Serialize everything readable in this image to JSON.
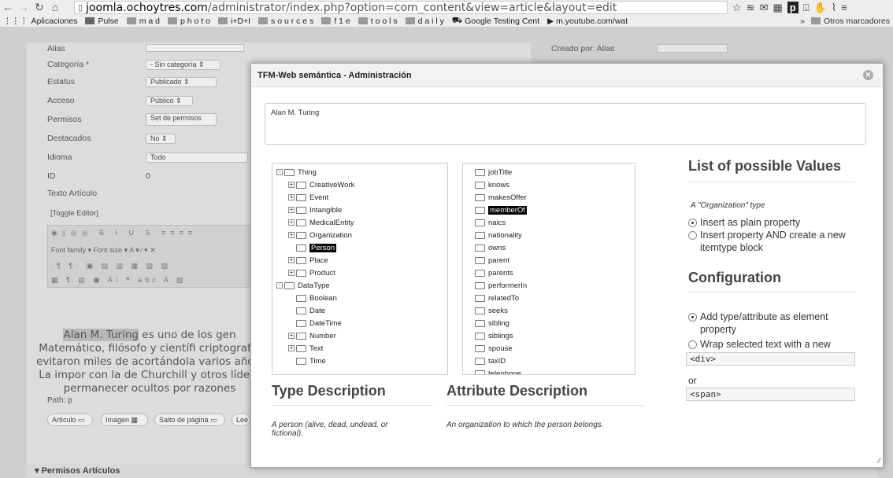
{
  "browser": {
    "url_host": "joomla.ochoytres.com",
    "url_path": "/administrator/index.php?option=com_content&view=article&layout=edit",
    "bookmarks": [
      "Aplicaciones",
      "Pulse",
      "m a d",
      "p h o t o",
      "i+D+I",
      "s o u r c e s",
      "f 1 e",
      "t o o l s",
      "d a i l y",
      "Google Testing Cent",
      "m.youtube.com/wat"
    ],
    "bookmarks_more": "Otros marcadores"
  },
  "form": {
    "alias": "Alias",
    "categoria_label": "Categoría *",
    "categoria_value": "- Sin categoría",
    "estatus_label": "Estatus",
    "estatus_value": "Publicado",
    "acceso_label": "Acceso",
    "acceso_value": "Público",
    "permisos_label": "Permisos",
    "permisos_btn": "Set de permisos",
    "destacados_label": "Destacados",
    "destacados_value": "No",
    "idioma_label": "Idioma",
    "idioma_value": "Todo",
    "id_label": "ID",
    "id_value": "0",
    "texto_label": "Texto Artículo",
    "toggle": "[Toggle Editor]",
    "font_family": "Font family",
    "font_size": "Font size",
    "creado_por": "Creado por: Alias",
    "editor_hl": "Alan M. Turing",
    "editor_rest": " es uno de los gen Matemático, filósofo y científi criptografía evitaron miles de acortándola varios años. La impor con la de Churchill y otros lídere permanecer ocultos por razones",
    "path": "Path: p",
    "btn_articulo": "Artículo",
    "btn_imagen": "Imagen",
    "btn_salto": "Salto de página",
    "btn_lee": "Lee",
    "permisos_articulos": "Permisos Artículos"
  },
  "modal": {
    "title": "TFM-Web semántica - Administración",
    "text": "Alan M. Turing",
    "types": [
      {
        "t": "Thing",
        "d": 0,
        "tog": "-",
        "open": true
      },
      {
        "t": "CreativeWork",
        "d": 1,
        "tog": "+"
      },
      {
        "t": "Event",
        "d": 1,
        "tog": "+"
      },
      {
        "t": "Intangible",
        "d": 1,
        "tog": "+"
      },
      {
        "t": "MedicalEntity",
        "d": 1,
        "tog": "+"
      },
      {
        "t": "Organization",
        "d": 1,
        "tog": "+"
      },
      {
        "t": "Person",
        "d": 1,
        "tog": "",
        "sel": true
      },
      {
        "t": "Place",
        "d": 1,
        "tog": "+"
      },
      {
        "t": "Product",
        "d": 1,
        "tog": "+"
      },
      {
        "t": "DataType",
        "d": 0,
        "tog": "-",
        "open": true
      },
      {
        "t": "Boolean",
        "d": 1,
        "tog": ""
      },
      {
        "t": "Date",
        "d": 1,
        "tog": ""
      },
      {
        "t": "DateTime",
        "d": 1,
        "tog": ""
      },
      {
        "t": "Number",
        "d": 1,
        "tog": "+"
      },
      {
        "t": "Text",
        "d": 1,
        "tog": "+"
      },
      {
        "t": "Time",
        "d": 1,
        "tog": ""
      }
    ],
    "attrs": [
      "jobTitle",
      "knows",
      "makesOffer",
      "memberOf",
      "naics",
      "nationality",
      "owns",
      "parent",
      "parents",
      "performerIn",
      "relatedTo",
      "seeks",
      "sibling",
      "siblings",
      "spouse",
      "taxID",
      "telephone"
    ],
    "attr_selected": "memberOf",
    "type_desc_title": "Type Description",
    "type_desc": "A person (alive, dead, undead, or fictional).",
    "attr_desc_title": "Attribute Description",
    "attr_desc": "An organization to which the person belongs.",
    "values_title": "List of possible Values",
    "values_type": "A \"Organization\" type",
    "opt1": "Insert as plain property",
    "opt2": "Insert property AND create a new itemtype block",
    "config_title": "Configuration",
    "cfg1": "Add type/attribute as element property",
    "cfg2": "Wrap selected text with a new",
    "div_tag": "<div>",
    "or": "or",
    "span_tag": "<span>"
  }
}
